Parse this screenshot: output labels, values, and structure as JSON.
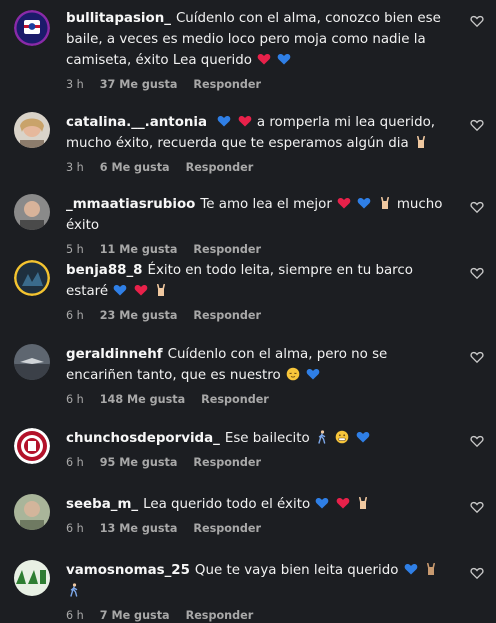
{
  "comments": [
    {
      "username": "bullitapasion_",
      "text": "Cuídenlo con el alma, conozco bien ese baile, a veces es medio loco pero moja como nadie la camiseta, éxito Lea querido",
      "emojis_after": [
        "red-heart",
        "blue-heart"
      ],
      "time": "3 h",
      "likes": "37 Me gusta",
      "reply": "Responder"
    },
    {
      "username": "catalina.__.antonia",
      "text_pre_emojis": [
        "blue-heart",
        "red-heart"
      ],
      "text": "a romperla mi lea querido, mucho éxito, recuerda que te esperamos algún dia",
      "emojis_after": [
        "horns-hand"
      ],
      "time": "3 h",
      "likes": "6 Me gusta",
      "reply": "Responder"
    },
    {
      "username": "_mmaatiasrubioo",
      "text": "Te amo lea el mejor",
      "emojis_mid": [
        "red-heart",
        "blue-heart",
        "horns-hand"
      ],
      "text_after": "mucho éxito",
      "time": "5 h",
      "likes": "11 Me gusta",
      "reply": "Responder"
    },
    {
      "username": "benja88_8",
      "text": "Éxito en todo leita, siempre en tu barco estaré",
      "emojis_after": [
        "blue-heart",
        "red-heart",
        "horns-hand"
      ],
      "time": "6 h",
      "likes": "23 Me gusta",
      "reply": "Responder"
    },
    {
      "username": "geraldinnehf",
      "text": "Cuídenlo con el alma, pero no se encariñen tanto, que es nuestro",
      "emojis_after": [
        "relieved-face",
        "blue-heart"
      ],
      "time": "6 h",
      "likes": "148 Me gusta",
      "reply": "Responder"
    },
    {
      "username": "chunchosdeporvida_",
      "text": "Ese bailecito",
      "emojis_after": [
        "person-walking",
        "grimacing-face",
        "blue-heart"
      ],
      "time": "6 h",
      "likes": "95 Me gusta",
      "reply": "Responder"
    },
    {
      "username": "seeba_m_",
      "text": "Lea querido todo el éxito",
      "emojis_after": [
        "blue-heart",
        "red-heart",
        "horns-hand"
      ],
      "time": "6 h",
      "likes": "13 Me gusta",
      "reply": "Responder"
    },
    {
      "username": "vamosnomas_25",
      "text": "Que te vaya bien leita querido",
      "emojis_after": [
        "blue-heart",
        "horns-hand",
        "person-walking"
      ],
      "time": "6 h",
      "likes": "7 Me gusta",
      "reply": "Responder"
    }
  ],
  "colors": {
    "background": "#1c1e22",
    "text": "#f2f2f2",
    "muted": "#a8a8a8",
    "red_heart": "#e8214a",
    "blue_heart": "#2f7fe6"
  }
}
